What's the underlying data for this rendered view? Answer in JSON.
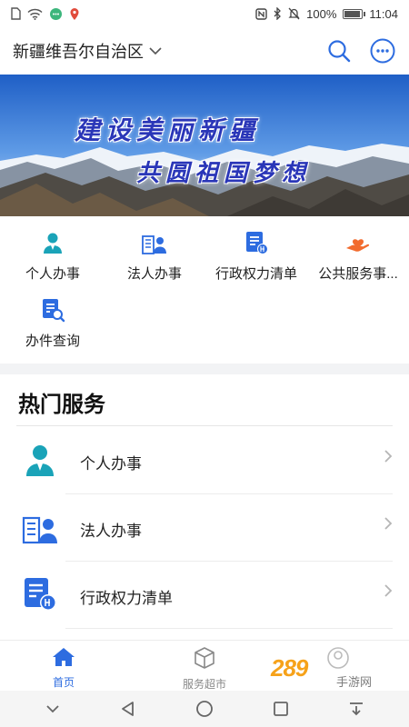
{
  "status_bar": {
    "battery": "100%",
    "battery_level": 1.0,
    "time": "11:04",
    "left_icons": [
      "sim-icon",
      "wifi-icon",
      "chat-icon",
      "location-icon"
    ],
    "right_icons": [
      "nfc-icon",
      "bluetooth-icon",
      "mute-icon",
      "battery-icon"
    ]
  },
  "top_bar": {
    "region": "新疆维吾尔自治区",
    "region_icon": "chevron-down-icon",
    "search_icon": "search-icon",
    "more_icon": "more-icon"
  },
  "banner": {
    "line1": "建设美丽新疆",
    "line2": "共圆祖国梦想"
  },
  "quick_grid": {
    "items": [
      {
        "label": "个人办事",
        "icon": "person-icon"
      },
      {
        "label": "法人办事",
        "icon": "building-person-icon"
      },
      {
        "label": "行政权力清单",
        "icon": "power-list-icon"
      },
      {
        "label": "公共服务事...",
        "icon": "hand-heart-icon"
      },
      {
        "label": "办件查询",
        "icon": "document-search-icon"
      }
    ]
  },
  "hot_services": {
    "title": "热门服务",
    "items": [
      {
        "label": "个人办事",
        "icon": "person-icon"
      },
      {
        "label": "法人办事",
        "icon": "building-person-icon"
      },
      {
        "label": "行政权力清单",
        "icon": "power-list-icon"
      }
    ]
  },
  "tab_bar": {
    "tabs": [
      {
        "label": "首页",
        "icon": "home-icon",
        "active": true
      },
      {
        "label": "服务超市",
        "icon": "cube-icon",
        "active": false
      },
      {
        "label": "",
        "icon": "user-icon",
        "active": false
      }
    ]
  },
  "watermark": {
    "brand": "289",
    "suffix": "手游网"
  },
  "colors": {
    "accent": "#2d6ce0",
    "teal": "#1aa3b8",
    "orange": "#f26b2e",
    "watermark": "#f6a21a"
  }
}
